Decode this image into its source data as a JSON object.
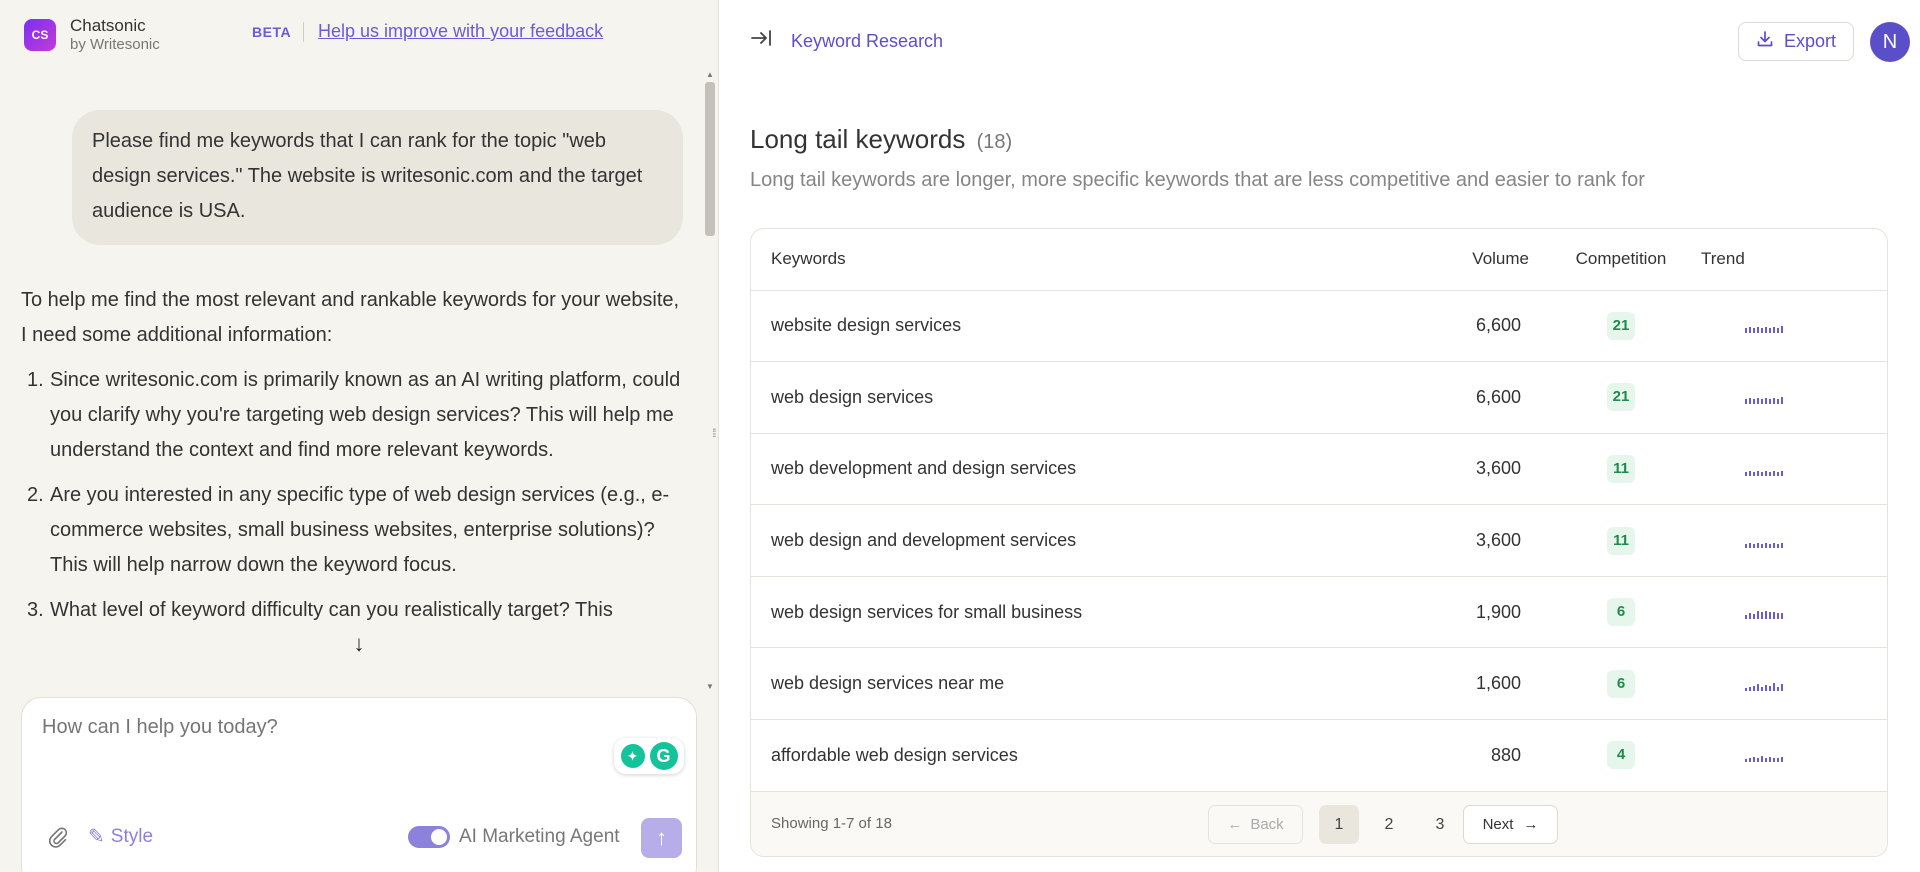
{
  "brand": {
    "logo_text": "CS",
    "name": "Chatsonic",
    "sub": "by Writesonic"
  },
  "header": {
    "beta": "BETA",
    "feedback": "Help us improve with your feedback"
  },
  "chat": {
    "user_message": "Please find me keywords that I can rank for the topic \"web design services.\" The website is writesonic.com and the target audience is USA.",
    "assistant_intro": "To help me find the most relevant and rankable keywords for your website, I need some additional information:",
    "assistant_items": [
      {
        "num": "1.",
        "text": "Since writesonic.com is primarily known as an AI writing platform, could you clarify why you're targeting web design services? This will help me understand the context and find more relevant keywords."
      },
      {
        "num": "2.",
        "text": "Are you interested in any specific type of web design services (e.g., e-commerce websites, small business websites, enterprise solutions)? This will help narrow down the keyword focus."
      },
      {
        "num": "3.",
        "text": "What level of keyword difficulty can you realistically target? This"
      }
    ]
  },
  "composer": {
    "placeholder": "How can I help you today?",
    "style_label": "Style",
    "agent_label": "AI Marketing Agent",
    "agent_enabled": true
  },
  "panel": {
    "title": "Keyword Research",
    "export_label": "Export",
    "avatar_initial": "N",
    "section_title": "Long tail keywords",
    "section_count": "(18)",
    "section_desc": "Long tail keywords are longer, more specific keywords that are less competitive and easier to rank for"
  },
  "table": {
    "headers": {
      "keywords": "Keywords",
      "volume": "Volume",
      "competition": "Competition",
      "trend": "Trend"
    },
    "rows": [
      {
        "keyword": "website design services",
        "volume": "6,600",
        "competition": "21"
      },
      {
        "keyword": "web design services",
        "volume": "6,600",
        "competition": "21"
      },
      {
        "keyword": "web development and design services",
        "volume": "3,600",
        "competition": "11"
      },
      {
        "keyword": "web design and development services",
        "volume": "3,600",
        "competition": "11"
      },
      {
        "keyword": "web design services for small business",
        "volume": "1,900",
        "competition": "6"
      },
      {
        "keyword": "web design services near me",
        "volume": "1,600",
        "competition": "6"
      },
      {
        "keyword": "affordable web design services",
        "volume": "880",
        "competition": "4"
      }
    ]
  },
  "pagination": {
    "showing": "Showing 1-7 of 18",
    "back": "Back",
    "next": "Next",
    "pages": [
      "1",
      "2",
      "3"
    ],
    "current_page": "1"
  },
  "colors": {
    "accent": "#5b4fc9",
    "competition_bg": "#e6f6ec",
    "competition_text": "#1f8a4c",
    "pane_bg": "#f6f4ef"
  }
}
